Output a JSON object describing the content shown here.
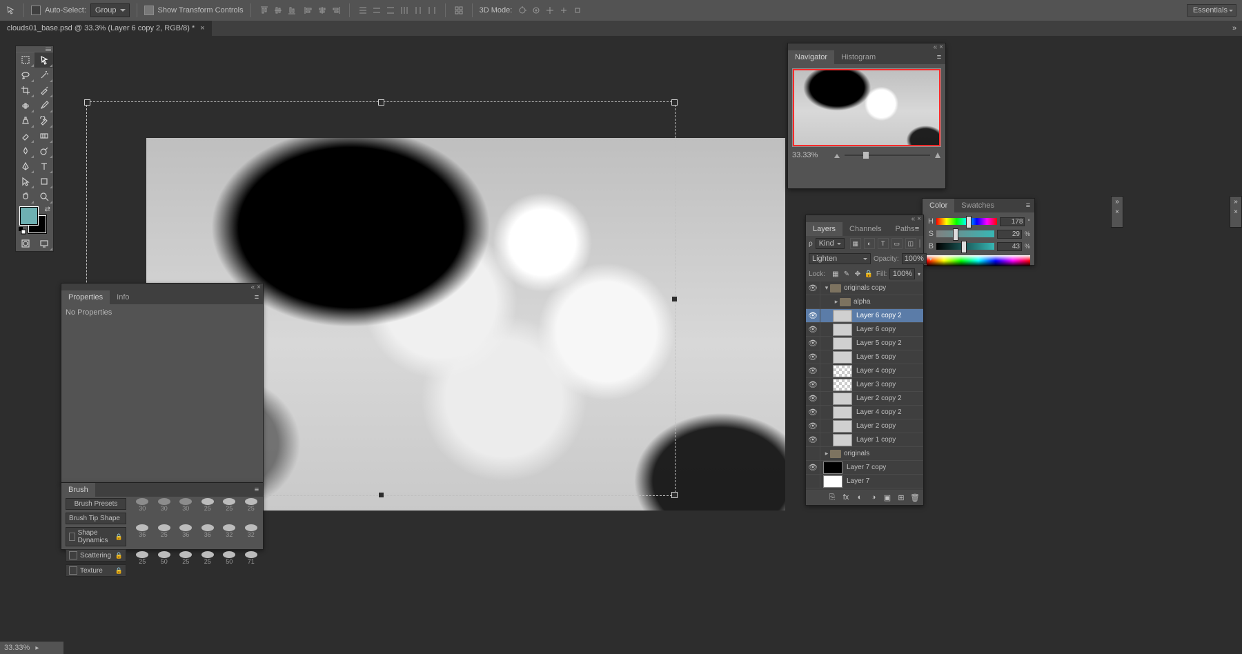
{
  "options_bar": {
    "auto_select_label": "Auto-Select:",
    "auto_select_checked": false,
    "group_dropdown": "Group",
    "show_transform_label": "Show Transform Controls",
    "show_transform_checked": true,
    "mode3d_label": "3D Mode:",
    "workspace": "Essentials"
  },
  "doc_tab": {
    "title": "clouds01_base.psd @ 33.3% (Layer 6 copy 2, RGB/8) *"
  },
  "status": {
    "zoom": "33.33%"
  },
  "navigator": {
    "tab_navigator": "Navigator",
    "tab_histogram": "Histogram",
    "zoom": "33.33%"
  },
  "color": {
    "tab_color": "Color",
    "tab_swatches": "Swatches",
    "h_label": "H",
    "h_value": "178",
    "s_label": "S",
    "s_value": "29",
    "b_label": "B",
    "b_value": "43"
  },
  "properties": {
    "tab_properties": "Properties",
    "tab_info": "Info",
    "no_props": "No Properties"
  },
  "brush": {
    "tab_brush": "Brush",
    "presets_btn": "Brush Presets",
    "tip_shape": "Brush Tip Shape",
    "shape_dynamics": "Shape Dynamics",
    "scattering": "Scattering",
    "texture": "Texture",
    "sizes_row1": [
      "30",
      "30",
      "30",
      "25",
      "25",
      "25"
    ],
    "sizes_row2": [
      "36",
      "25",
      "36",
      "36",
      "32",
      "32"
    ],
    "sizes_row3": [
      "25",
      "50",
      "25",
      "25",
      "50",
      "71"
    ]
  },
  "layers": {
    "tab_layers": "Layers",
    "tab_channels": "Channels",
    "tab_paths": "Paths",
    "filter_kind": "Kind",
    "blend_mode": "Lighten",
    "opacity_label": "Opacity:",
    "opacity_value": "100%",
    "lock_label": "Lock:",
    "fill_label": "Fill:",
    "fill_value": "100%",
    "items": [
      {
        "type": "group",
        "name": "originals copy",
        "open": true,
        "indent": 0,
        "eye": true
      },
      {
        "type": "group",
        "name": "alpha",
        "open": false,
        "indent": 1,
        "eye": false,
        "thumb": "folder"
      },
      {
        "type": "layer",
        "name": "Layer 6 copy 2",
        "indent": 1,
        "eye": true,
        "thumb": "img",
        "selected": true
      },
      {
        "type": "layer",
        "name": "Layer 6 copy",
        "indent": 1,
        "eye": true,
        "thumb": "img"
      },
      {
        "type": "layer",
        "name": "Layer 5 copy 2",
        "indent": 1,
        "eye": true,
        "thumb": "img"
      },
      {
        "type": "layer",
        "name": "Layer 5 copy",
        "indent": 1,
        "eye": true,
        "thumb": "img"
      },
      {
        "type": "layer",
        "name": "Layer 4 copy",
        "indent": 1,
        "eye": true,
        "thumb": "checker"
      },
      {
        "type": "layer",
        "name": "Layer 3 copy",
        "indent": 1,
        "eye": true,
        "thumb": "checker"
      },
      {
        "type": "layer",
        "name": "Layer 2 copy 2",
        "indent": 1,
        "eye": true,
        "thumb": "img"
      },
      {
        "type": "layer",
        "name": "Layer 4 copy 2",
        "indent": 1,
        "eye": true,
        "thumb": "img"
      },
      {
        "type": "layer",
        "name": "Layer 2 copy",
        "indent": 1,
        "eye": true,
        "thumb": "img"
      },
      {
        "type": "layer",
        "name": "Layer 1 copy",
        "indent": 1,
        "eye": true,
        "thumb": "img"
      },
      {
        "type": "group",
        "name": "originals",
        "open": false,
        "indent": 0,
        "eye": false,
        "thumb": "folder"
      },
      {
        "type": "layer",
        "name": "Layer 7 copy",
        "indent": 0,
        "eye": true,
        "thumb": "black"
      },
      {
        "type": "layer",
        "name": "Layer 7",
        "indent": 0,
        "eye": false,
        "thumb": "white"
      }
    ]
  }
}
